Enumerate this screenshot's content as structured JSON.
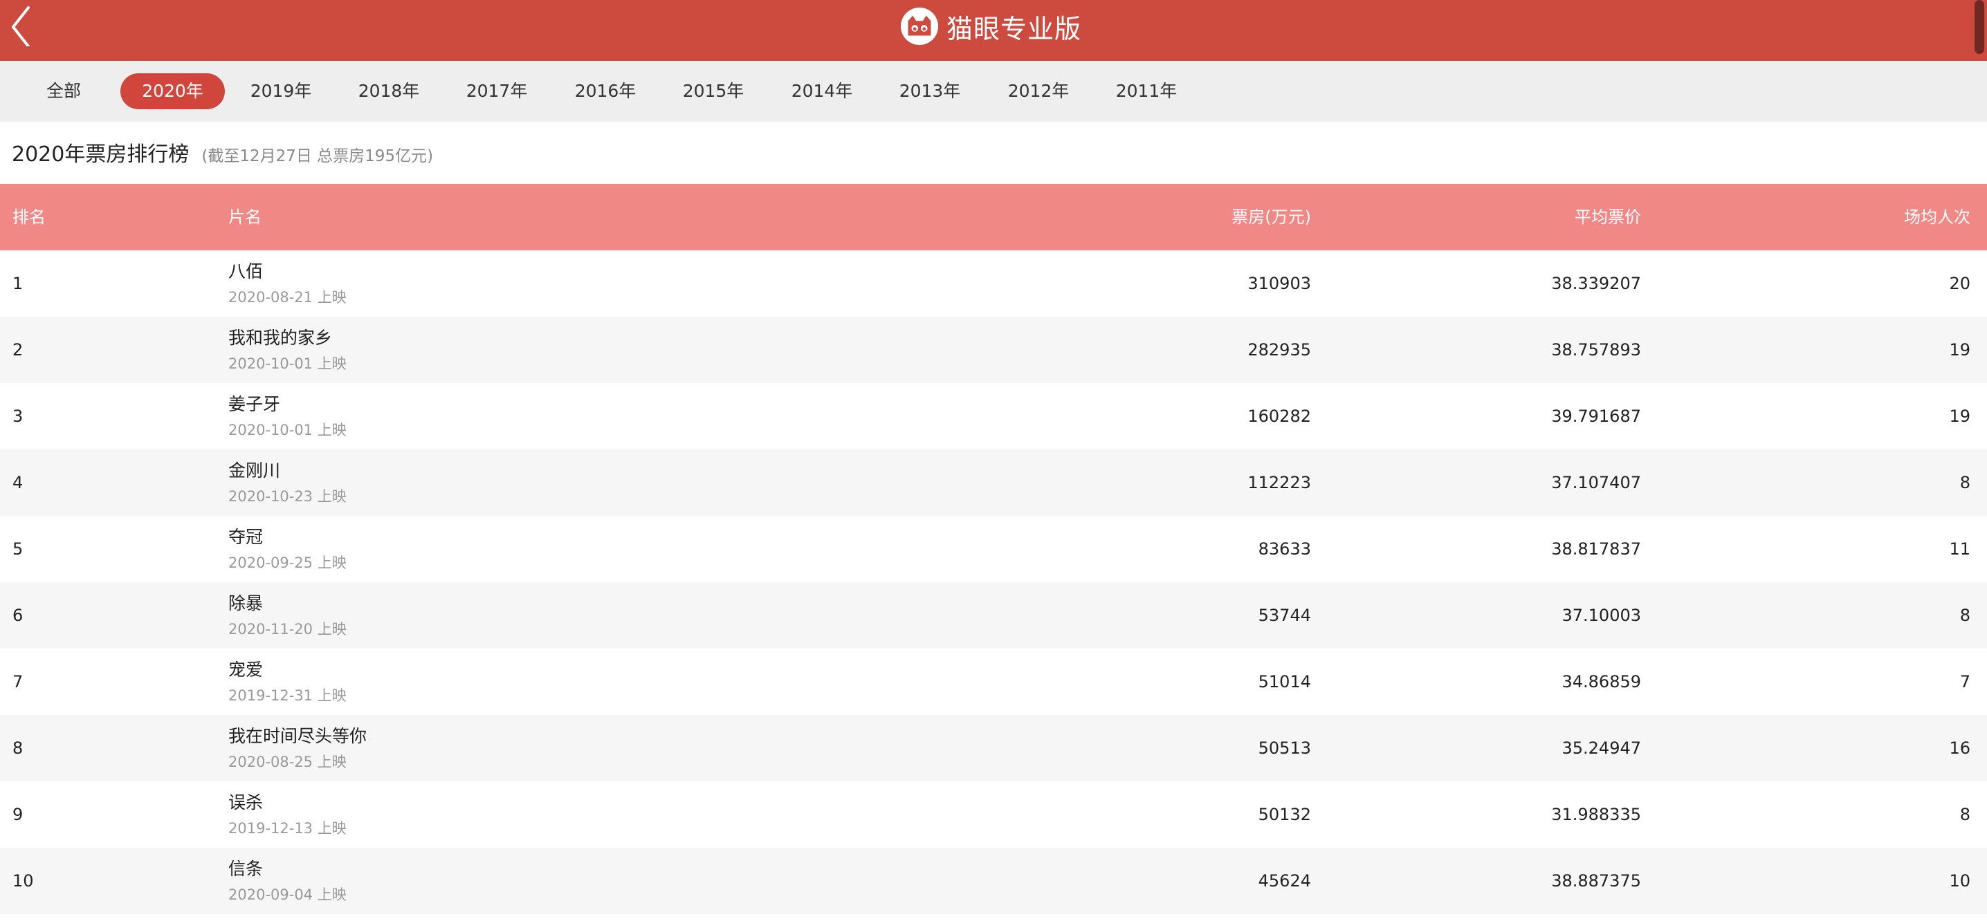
{
  "header": {
    "app_name": "猫眼专业版",
    "brand_color": "#cd4a3f",
    "back_icon": "chevron-left-icon",
    "logo_icon": "cat-face-logo-icon"
  },
  "year_tabs": [
    {
      "label": "全部",
      "active": false
    },
    {
      "label": "2020年",
      "active": true
    },
    {
      "label": "2019年",
      "active": false
    },
    {
      "label": "2018年",
      "active": false
    },
    {
      "label": "2017年",
      "active": false
    },
    {
      "label": "2016年",
      "active": false
    },
    {
      "label": "2015年",
      "active": false
    },
    {
      "label": "2014年",
      "active": false
    },
    {
      "label": "2013年",
      "active": false
    },
    {
      "label": "2012年",
      "active": false
    },
    {
      "label": "2011年",
      "active": false
    }
  ],
  "section": {
    "title": "2020年票房排行榜",
    "subtitle": "(截至12月27日 总票房195亿元)"
  },
  "table": {
    "header_color": "#f08885",
    "columns": {
      "rank": "排名",
      "title": "片名",
      "box_office": "票房(万元)",
      "avg_price": "平均票价",
      "avg_audience": "场均人次"
    },
    "rows": [
      {
        "rank": "1",
        "title": "八佰",
        "release": "2020-08-21 上映",
        "box_office": "310903",
        "avg_price": "38.339207",
        "avg_audience": "20"
      },
      {
        "rank": "2",
        "title": "我和我的家乡",
        "release": "2020-10-01 上映",
        "box_office": "282935",
        "avg_price": "38.757893",
        "avg_audience": "19"
      },
      {
        "rank": "3",
        "title": "姜子牙",
        "release": "2020-10-01 上映",
        "box_office": "160282",
        "avg_price": "39.791687",
        "avg_audience": "19"
      },
      {
        "rank": "4",
        "title": "金刚川",
        "release": "2020-10-23 上映",
        "box_office": "112223",
        "avg_price": "37.107407",
        "avg_audience": "8"
      },
      {
        "rank": "5",
        "title": "夺冠",
        "release": "2020-09-25 上映",
        "box_office": "83633",
        "avg_price": "38.817837",
        "avg_audience": "11"
      },
      {
        "rank": "6",
        "title": "除暴",
        "release": "2020-11-20 上映",
        "box_office": "53744",
        "avg_price": "37.10003",
        "avg_audience": "8"
      },
      {
        "rank": "7",
        "title": "宠爱",
        "release": "2019-12-31 上映",
        "box_office": "51014",
        "avg_price": "34.86859",
        "avg_audience": "7"
      },
      {
        "rank": "8",
        "title": "我在时间尽头等你",
        "release": "2020-08-25 上映",
        "box_office": "50513",
        "avg_price": "35.24947",
        "avg_audience": "16"
      },
      {
        "rank": "9",
        "title": "误杀",
        "release": "2019-12-13 上映",
        "box_office": "50132",
        "avg_price": "31.988335",
        "avg_audience": "8"
      },
      {
        "rank": "10",
        "title": "信条",
        "release": "2020-09-04 上映",
        "box_office": "45624",
        "avg_price": "38.887375",
        "avg_audience": "10"
      }
    ]
  }
}
